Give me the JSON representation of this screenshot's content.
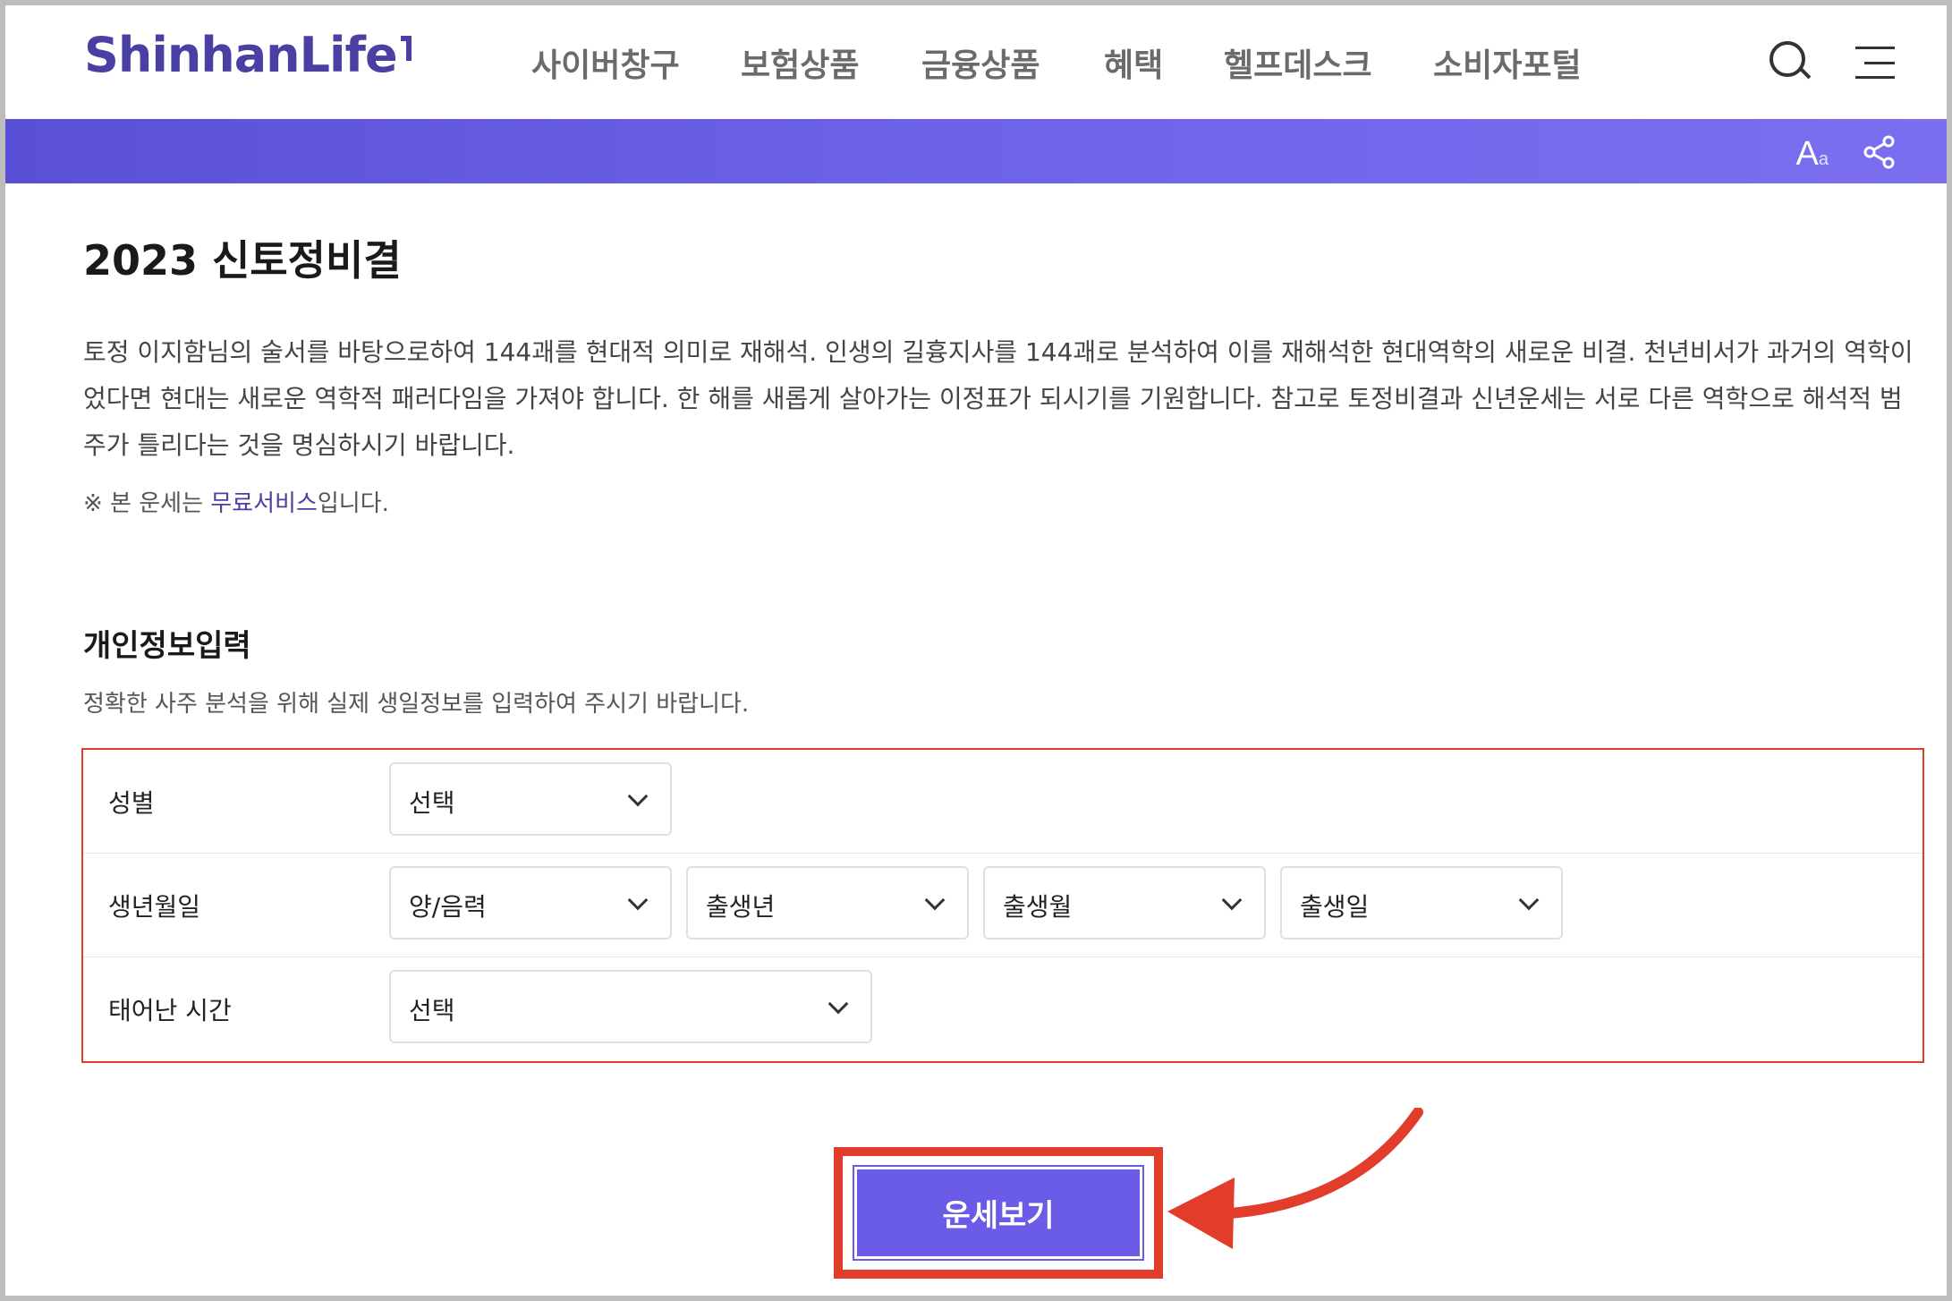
{
  "header": {
    "logo": "ShinhanLife",
    "nav": [
      "사이버창구",
      "보험상품",
      "금융상품",
      "혜택",
      "헬프데스크",
      "소비자포털"
    ]
  },
  "toolbar": {
    "font_size_label": "A",
    "font_size_sub": "a"
  },
  "page": {
    "title": "2023 신토정비결",
    "description": "토정 이지함님의 술서를 바탕으로하여 144괘를 현대적 의미로 재해석. 인생의 길흉지사를 144괘로 분석하여 이를 재해석한 현대역학의 새로운 비결. 천년비서가 과거의 역학이었다면 현대는 새로운 역학적 패러다임을 가져야 합니다. 한 해를 새롭게 살아가는 이정표가 되시기를 기원합니다. 참고로 토정비결과 신년운세는 서로 다른 역학으로 해석적 범주가 틀리다는 것을 명심하시기 바랍니다.",
    "notice_prefix": "※ 본 운세는 ",
    "notice_link": "무료서비스",
    "notice_suffix": "입니다."
  },
  "form": {
    "title": "개인정보입력",
    "desc": "정확한 사주 분석을 위해 실제 생일정보를 입력하여 주시기 바랍니다.",
    "gender": {
      "label": "성별",
      "value": "선택"
    },
    "birth": {
      "label": "생년월일",
      "calendar": "양/음력",
      "year": "출생년",
      "month": "출생월",
      "day": "출생일"
    },
    "time": {
      "label": "태어난 시간",
      "value": "선택"
    },
    "submit": "운세보기"
  },
  "colors": {
    "accent": "#6a5ce6",
    "brand": "#4a3fa3",
    "highlight": "#e23c2a"
  }
}
